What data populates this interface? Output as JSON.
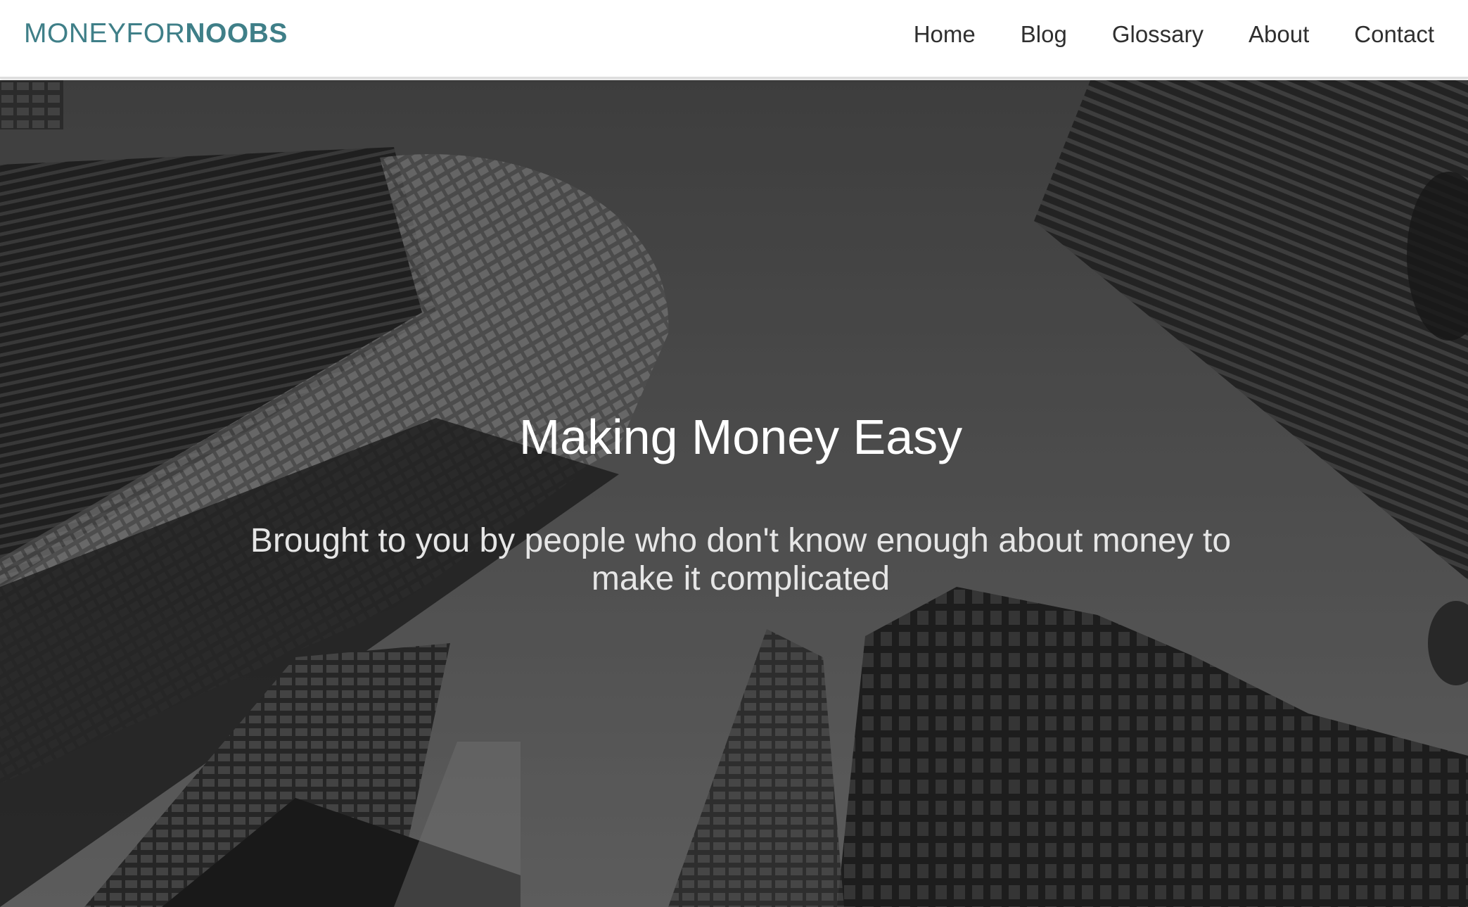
{
  "header": {
    "logo_light": "MONEYFOR",
    "logo_bold": "NOOBS",
    "nav": [
      {
        "label": "Home"
      },
      {
        "label": "Blog"
      },
      {
        "label": "Glossary"
      },
      {
        "label": "About"
      },
      {
        "label": "Contact"
      }
    ]
  },
  "hero": {
    "title": "Making Money Easy",
    "subtitle": "Brought to you by people who don't know enough about money to make it complicated",
    "background": "city-skyscrapers-image"
  },
  "colors": {
    "brand": "#3f7f88",
    "nav_text": "#2f2f2f",
    "hero_text": "#ffffff"
  }
}
